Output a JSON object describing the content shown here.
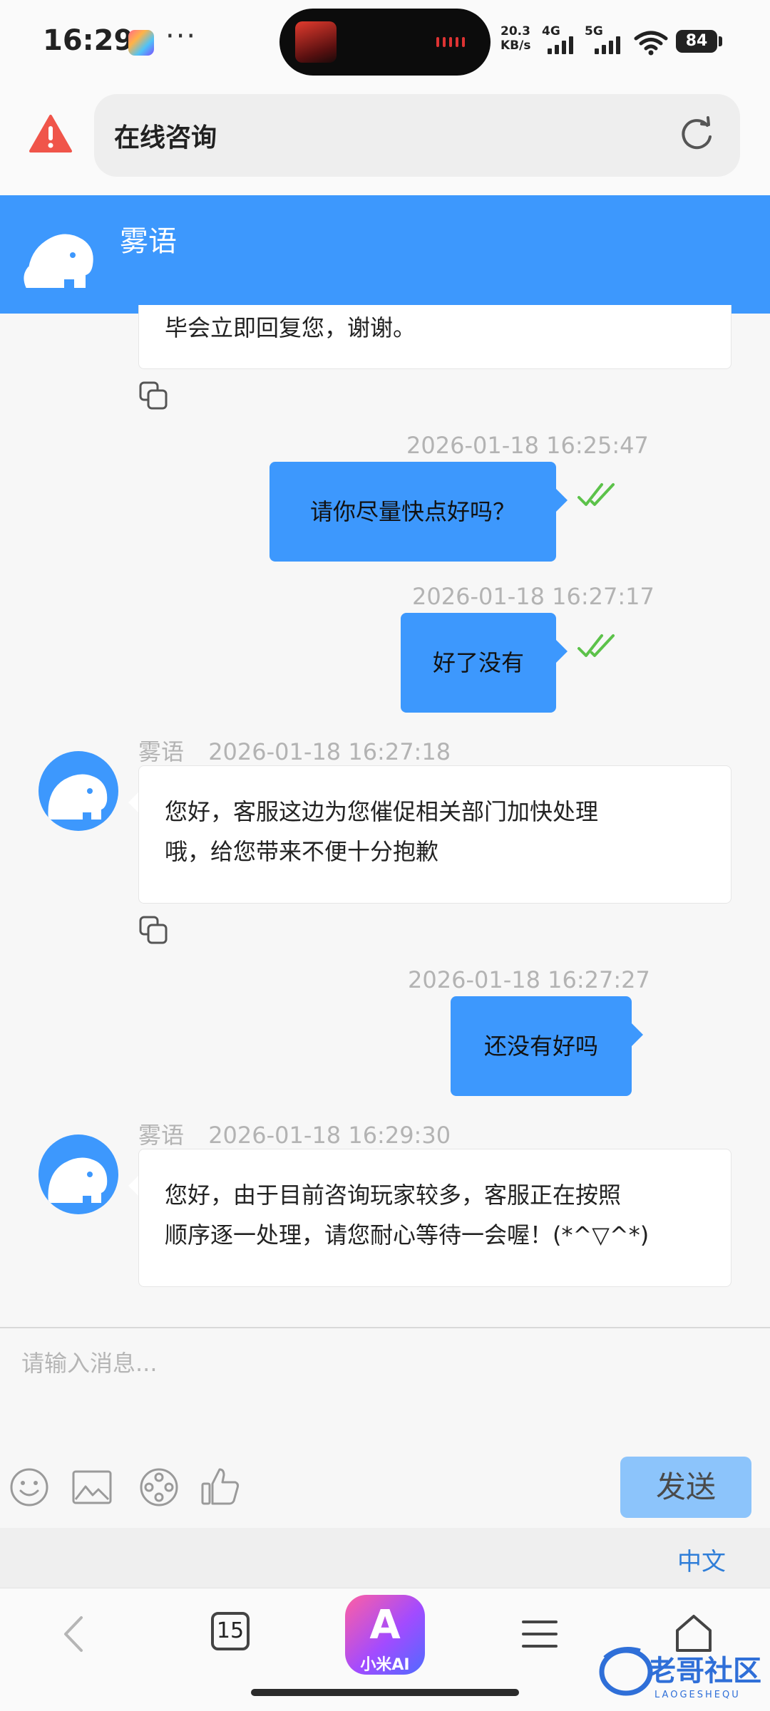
{
  "status_bar": {
    "time": "16:29",
    "more": "···",
    "net_speed_value": "20.3",
    "net_speed_unit": "KB/s",
    "net_4g": "4G",
    "net_5g": "5G",
    "battery": "84"
  },
  "browser": {
    "page_title": "在线咨询"
  },
  "chat": {
    "agent_name": "雾语",
    "truncated_message": "毕会立即回复您，谢谢。",
    "messages": [
      {
        "timestamp": "2026-01-18 16:25:47",
        "text": "请你尽量快点好吗？",
        "read": true
      },
      {
        "timestamp": "2026-01-18 16:27:17",
        "text": "好了没有",
        "read": true
      },
      {
        "sender": "雾语",
        "timestamp": "2026-01-18 16:27:18",
        "line1": "您好，客服这边为您催促相关部门加快处理",
        "line2": "哦，给您带来不便十分抱歉"
      },
      {
        "timestamp": "2026-01-18 16:27:27",
        "text": "还没有好吗",
        "read": false
      },
      {
        "sender": "雾语",
        "timestamp": "2026-01-18 16:29:30",
        "line1": "您好，由于目前咨询玩家较多，客服正在按照",
        "line2": "顺序逐一处理，请您耐心等待一会喔！(*^▽^*)"
      }
    ]
  },
  "input": {
    "placeholder": "请输入消息...",
    "send_label": "发送",
    "language": "中文"
  },
  "bottom_nav": {
    "tab_count": "15",
    "ai_label": "小米AI",
    "ai_letter": "A"
  },
  "watermark": {
    "text": "老哥社区",
    "subtext": "LAOGESHEQU"
  },
  "colors": {
    "accent": "#3d98fd",
    "send_button": "#8cc4fb",
    "read_check": "#5cc24a",
    "warning": "#f0554a"
  }
}
